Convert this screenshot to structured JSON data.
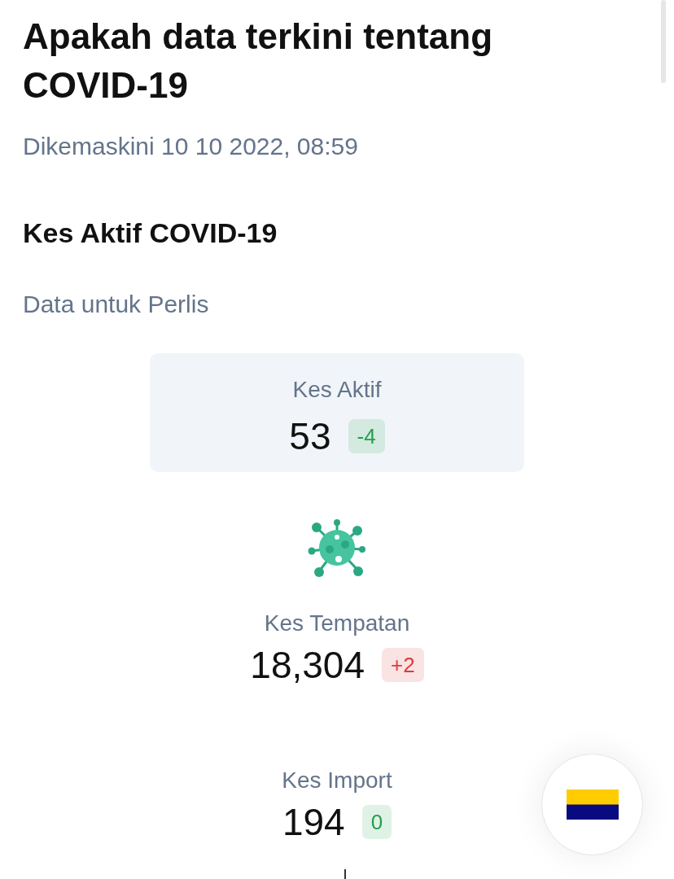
{
  "page": {
    "title": "Apakah data terkini tentang COVID-19",
    "updated": "Dikemaskini 10 10 2022, 08:59"
  },
  "section": {
    "heading": "Kes Aktif COVID-19",
    "subtitle": "Data untuk Perlis"
  },
  "summary_card": {
    "label": "Kes Aktif",
    "value": "53",
    "change": "-4",
    "color": "#22a04b"
  },
  "stats": [
    {
      "label": "Kes Tempatan",
      "value": "18,304",
      "change": "+2",
      "color": "#dc3c3c"
    },
    {
      "label": "Kes Import",
      "value": "194",
      "change": "0",
      "color": "#22a04b"
    }
  ]
}
